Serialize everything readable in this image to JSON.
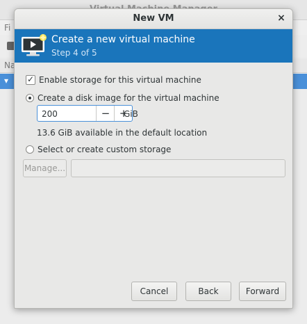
{
  "background": {
    "window_title": "Virtual Machine Manager",
    "menu_file": "Fi",
    "list_header": "Na",
    "selected_row": "▾"
  },
  "dialog": {
    "title": "New VM",
    "close": "×",
    "banner": {
      "title": "Create a new virtual machine",
      "step": "Step 4 of 5"
    },
    "enable_storage": {
      "label": "Enable storage for this virtual machine",
      "checked": true
    },
    "create_disk": {
      "label": "Create a disk image for the virtual machine",
      "selected": true
    },
    "disk_size": {
      "value": "200",
      "minus": "−",
      "plus": "+",
      "unit": "GiB"
    },
    "available": "13.6 GiB available in the default location",
    "custom_storage": {
      "label": "Select or create custom storage",
      "selected": false
    },
    "manage_label": "Manage...",
    "custom_path_value": "",
    "buttons": {
      "cancel": "Cancel",
      "back": "Back",
      "forward": "Forward"
    }
  },
  "colors": {
    "banner": "#1a75bb",
    "focus": "#4a90d9"
  }
}
